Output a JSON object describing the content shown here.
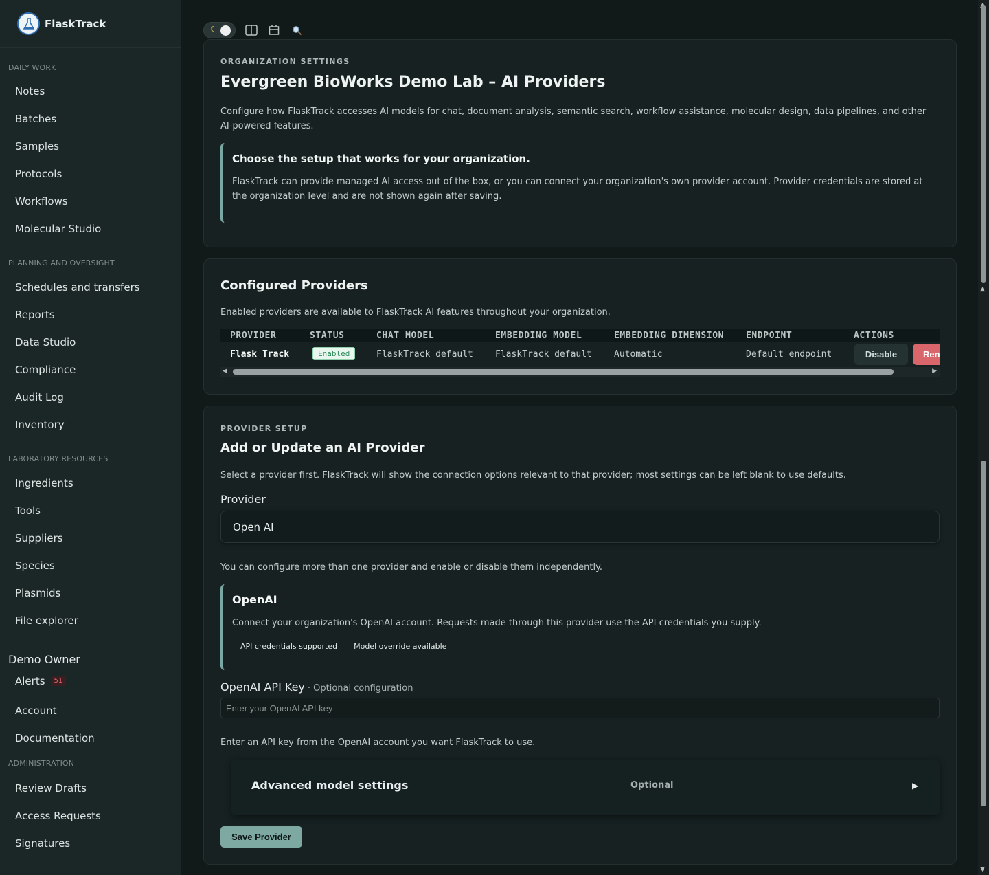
{
  "app": {
    "name": "FlaskTrack"
  },
  "sidebar": {
    "sections": [
      {
        "title": "DAILY WORK",
        "items": [
          "Notes",
          "Batches",
          "Samples",
          "Protocols",
          "Workflows",
          "Molecular Studio"
        ]
      },
      {
        "title": "PLANNING AND OVERSIGHT",
        "items": [
          "Schedules and transfers",
          "Reports",
          "Data Studio",
          "Compliance",
          "Audit Log",
          "Inventory"
        ]
      },
      {
        "title": "LABORATORY RESOURCES",
        "items": [
          "Ingredients",
          "Tools",
          "Suppliers",
          "Species",
          "Plasmids",
          "File explorer"
        ]
      }
    ],
    "user": {
      "name": "Demo Owner",
      "alerts_label": "Alerts",
      "alerts_count": "51",
      "account_label": "Account",
      "documentation_label": "Documentation"
    },
    "admin": {
      "title": "ADMINISTRATION",
      "items": [
        "Review Drafts",
        "Access Requests",
        "Signatures"
      ]
    }
  },
  "toolbar": {
    "icons": [
      "theme-toggle-icon",
      "split-view-icon",
      "calendar-icon",
      "search-icon"
    ]
  },
  "org_settings": {
    "eyebrow": "ORGANIZATION SETTINGS",
    "title": "Evergreen BioWorks Demo Lab – AI Providers",
    "description": "Configure how FlaskTrack accesses AI models for chat, document analysis, semantic search, workflow assistance, molecular design, data pipelines, and other AI-powered features.",
    "callout_title": "Choose the setup that works for your organization.",
    "callout_text": "FlaskTrack can provide managed AI access out of the box, or you can connect your organization's own provider account. Provider credentials are stored at the organization level and are not shown again after saving."
  },
  "configured": {
    "title": "Configured Providers",
    "description": "Enabled providers are available to FlaskTrack AI features throughout your organization.",
    "columns": [
      "PROVIDER",
      "STATUS",
      "CHAT MODEL",
      "EMBEDDING MODEL",
      "EMBEDDING DIMENSION",
      "ENDPOINT",
      "ACTIONS"
    ],
    "rows": [
      {
        "provider": "Flask Track",
        "status": "Enabled",
        "chat_model": "FlaskTrack default",
        "embedding_model": "FlaskTrack default",
        "embedding_dimension": "Automatic",
        "endpoint": "Default endpoint",
        "action_disable": "Disable",
        "action_remove": "Ren"
      }
    ]
  },
  "setup": {
    "eyebrow": "PROVIDER SETUP",
    "title": "Add or Update an AI Provider",
    "description": "Select a provider first. FlaskTrack will show the connection options relevant to that provider; most settings can be left blank to use defaults.",
    "provider_label": "Provider",
    "provider_value": "Open AI",
    "multi_note": "You can configure more than one provider and enable or disable them independently.",
    "callout_title": "OpenAI",
    "callout_text": "Connect your organization's OpenAI account. Requests made through this provider use the API credentials you supply.",
    "chips": [
      "API credentials supported",
      "Model override available"
    ],
    "api_key_label": "OpenAI API Key",
    "api_key_hint": "· Optional configuration",
    "api_key_placeholder": "Enter your OpenAI API key",
    "api_key_help": "Enter an API key from the OpenAI account you want FlaskTrack to use.",
    "advanced_title": "Advanced model settings",
    "advanced_optional": "Optional",
    "save_label": "Save Provider"
  }
}
